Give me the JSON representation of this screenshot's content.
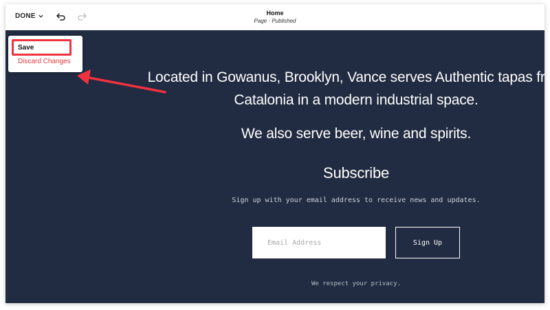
{
  "topbar": {
    "done_label": "DONE",
    "icons": [
      "chevron-down-icon",
      "undo-icon",
      "redo-icon"
    ],
    "page_title": "Home",
    "page_status": "Page · Published"
  },
  "menu": {
    "save_label": "Save",
    "discard_label": "Discard Changes"
  },
  "content": {
    "headline_line1": "Located in Gowanus, Brooklyn, Vance serves Authentic tapas from",
    "headline_line1b": "Catalonia in a modern industrial space.",
    "headline_line2": "We also serve beer, wine and spirits.",
    "subscribe_title": "Subscribe",
    "subscribe_text": "Sign up with your email address to receive news and updates.",
    "email_placeholder": "Email Address",
    "signup_label": "Sign Up",
    "privacy_text": "We respect your privacy."
  },
  "colors": {
    "canvas_bg": "#212b41",
    "annotation_red": "#f0323f",
    "discard_red": "#e23b3b"
  }
}
